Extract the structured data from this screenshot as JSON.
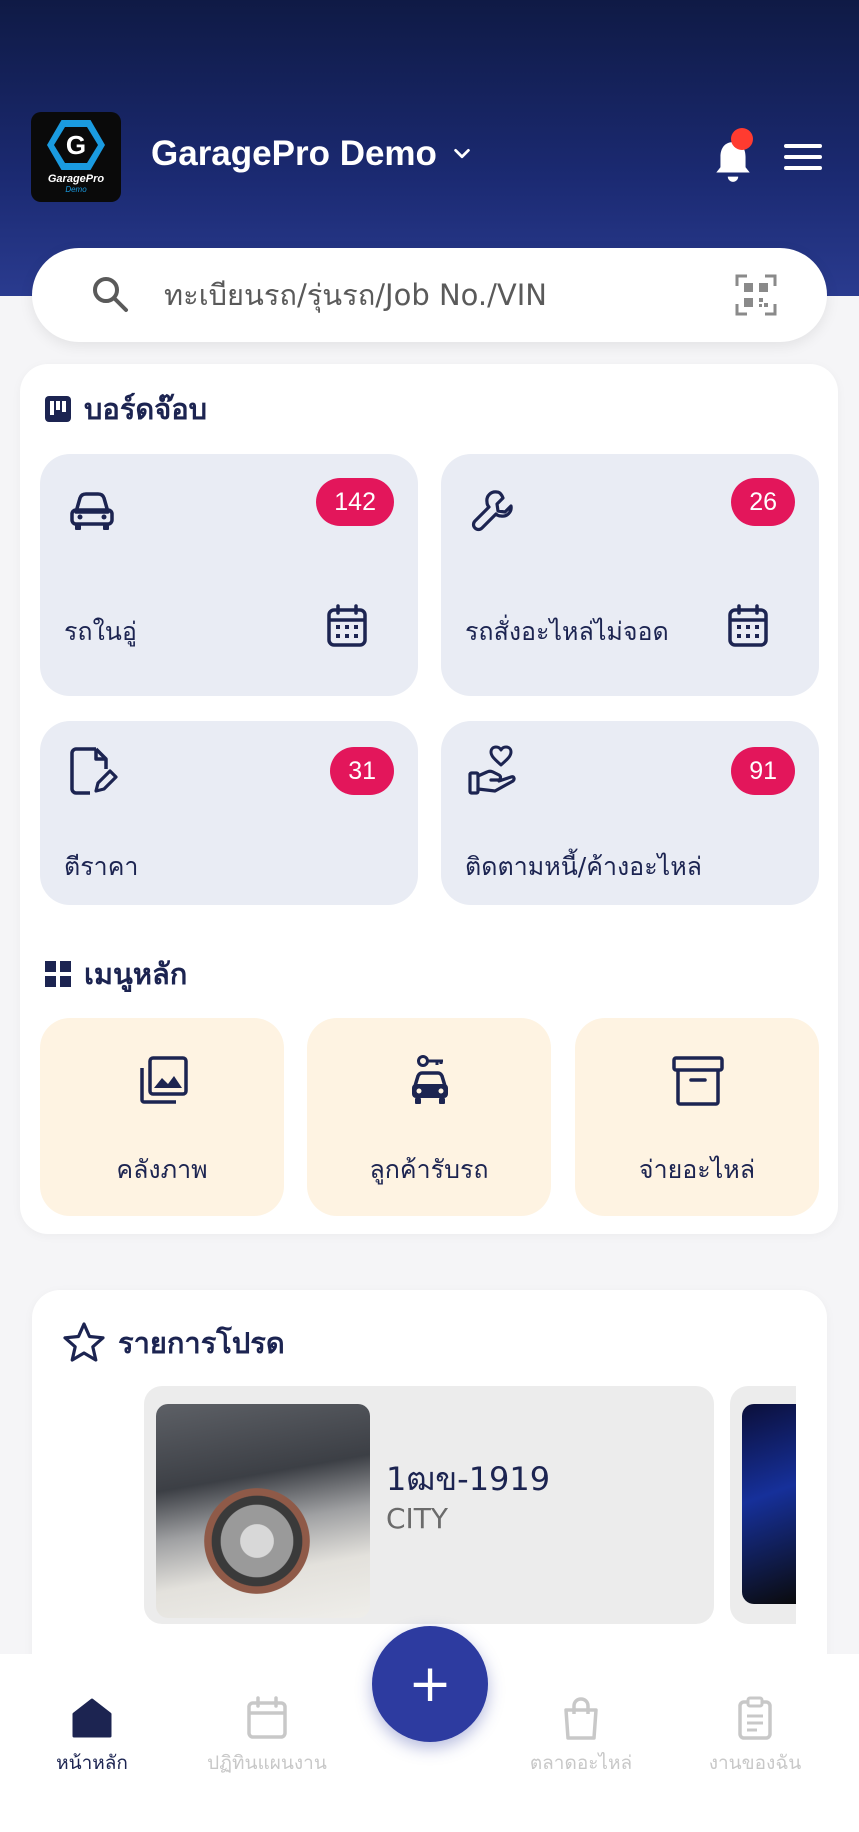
{
  "header": {
    "logo_text": "GaragePro",
    "logo_sub": "Demo",
    "title": "GaragePro Demo",
    "has_notification": true
  },
  "search": {
    "placeholder": "ทะเบียนรถ/รุ่นรถ/Job No./VIN"
  },
  "job_board": {
    "title": "บอร์ดจ๊อบ",
    "tiles": [
      {
        "label": "รถในอู่",
        "count": "142",
        "icon": "car-icon",
        "has_calendar": true
      },
      {
        "label": "รถสั่งอะไหล่ไม่จอด",
        "count": "26",
        "icon": "wrench-icon",
        "has_calendar": true
      },
      {
        "label": "ตีราคา",
        "count": "31",
        "icon": "document-edit-icon",
        "has_calendar": false
      },
      {
        "label": "ติดตามหนี้/ค้างอะไหล่",
        "count": "91",
        "icon": "hand-heart-icon",
        "has_calendar": false
      }
    ]
  },
  "main_menu": {
    "title": "เมนูหลัก",
    "items": [
      {
        "label": "คลังภาพ",
        "icon": "photo-library-icon"
      },
      {
        "label": "ลูกค้ารับรถ",
        "icon": "car-key-icon"
      },
      {
        "label": "จ่ายอะไหล่",
        "icon": "archive-box-icon"
      }
    ]
  },
  "favorites": {
    "title": "รายการโปรด",
    "items": [
      {
        "plate": "1ฒข-1919",
        "model": "CITY"
      }
    ]
  },
  "fab": {
    "label": "+"
  },
  "bottom_nav": {
    "items": [
      {
        "label": "หน้าหลัก",
        "icon": "home-icon",
        "active": true
      },
      {
        "label": "ปฏิทินแผนงาน",
        "icon": "calendar-icon",
        "active": false
      },
      {
        "label": "ตลาดอะไหล่",
        "icon": "shopping-bag-icon",
        "active": false
      },
      {
        "label": "งานของฉัน",
        "icon": "clipboard-icon",
        "active": false
      }
    ]
  },
  "colors": {
    "header_dark": "#0f1a45",
    "header_blue": "#2a3b8f",
    "badge": "#e3165b",
    "tile_bg": "#e9ecf4",
    "menu_tile_bg": "#fef3e2",
    "fab": "#2d3ba0",
    "notification_dot": "#ff3b30"
  }
}
